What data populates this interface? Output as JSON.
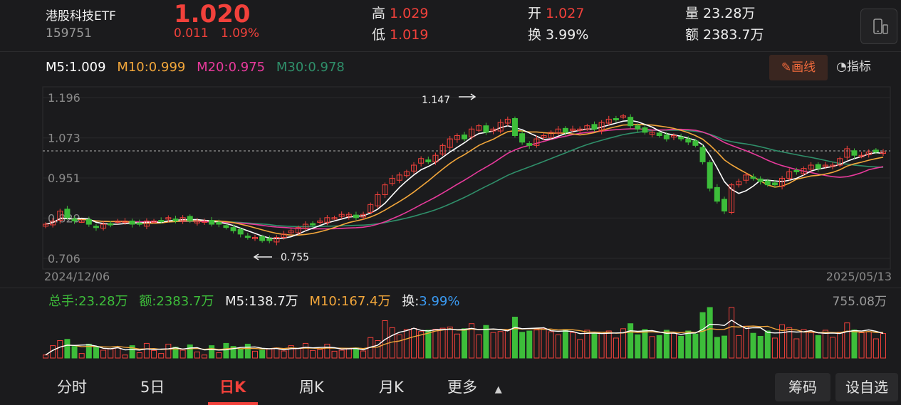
{
  "header": {
    "name": "港股科技ETF",
    "code": "159751",
    "price": "1.020",
    "change": "0.011",
    "change_pct": "1.09%",
    "high_label": "高",
    "high": "1.029",
    "low_label": "低",
    "low": "1.019",
    "open_label": "开",
    "open": "1.027",
    "turnover_label": "换",
    "turnover": "3.99%",
    "volume_label": "量",
    "volume": "23.28万",
    "amount_label": "额",
    "amount": "2383.7万"
  },
  "ma_legend": {
    "ma5": "M5:1.009",
    "ma10": "M10:0.999",
    "ma20": "M20:0.975",
    "ma30": "M30:0.978"
  },
  "colors": {
    "up": "#f2413b",
    "down": "#3dbd3a",
    "ma5": "#ffffff",
    "ma10": "#f3a73b",
    "ma20": "#e83a9c",
    "ma30": "#2f8f6a",
    "turnover": "#3a9af2",
    "accent": "#f06a3c"
  },
  "toolbar": {
    "draw_label": "画线",
    "indicator_label": "指标"
  },
  "chart": {
    "y_ticks": [
      "1.196",
      "1.073",
      "0.951",
      "0.829",
      "0.706"
    ],
    "start_date": "2024/12/06",
    "end_date": "2025/05/13",
    "high_annotation": "1.147",
    "low_annotation": "0.755"
  },
  "volume": {
    "total": "总手:23.28万",
    "amount": "额:2383.7万",
    "ma5": "M5:138.7万",
    "ma10": "M10:167.4万",
    "turnover_label": "换:",
    "turnover_value": "3.99%",
    "max": "755.08万"
  },
  "tabs": [
    {
      "label": "分时"
    },
    {
      "label": "5日"
    },
    {
      "label": "日K"
    },
    {
      "label": "周K"
    },
    {
      "label": "月K"
    },
    {
      "label": "更多"
    }
  ],
  "buttons": {
    "chips": "筹码",
    "settings": "设自选"
  },
  "icons": {
    "draw": "pencil-icon",
    "indicator": "gauge-icon",
    "more": "triangle-up-icon",
    "phone": "phone-icon"
  },
  "chart_data": {
    "type": "candlestick",
    "y_range": [
      0.706,
      1.196
    ],
    "close_series": [
      0.81,
      0.82,
      0.85,
      0.83,
      0.82,
      0.82,
      0.81,
      0.8,
      0.81,
      0.81,
      0.82,
      0.82,
      0.81,
      0.81,
      0.82,
      0.82,
      0.82,
      0.83,
      0.82,
      0.83,
      0.82,
      0.82,
      0.82,
      0.81,
      0.81,
      0.8,
      0.79,
      0.78,
      0.77,
      0.77,
      0.76,
      0.76,
      0.77,
      0.78,
      0.79,
      0.8,
      0.81,
      0.81,
      0.82,
      0.83,
      0.83,
      0.84,
      0.84,
      0.83,
      0.84,
      0.87,
      0.9,
      0.93,
      0.95,
      0.96,
      0.97,
      0.99,
      1.01,
      1.0,
      1.02,
      1.05,
      1.07,
      1.08,
      1.07,
      1.1,
      1.11,
      1.09,
      1.1,
      1.12,
      1.13,
      1.08,
      1.06,
      1.05,
      1.07,
      1.08,
      1.09,
      1.1,
      1.09,
      1.1,
      1.1,
      1.11,
      1.1,
      1.12,
      1.13,
      1.13,
      1.14,
      1.11,
      1.1,
      1.09,
      1.09,
      1.08,
      1.07,
      1.08,
      1.07,
      1.06,
      1.05,
      1.0,
      0.92,
      0.88,
      0.85,
      0.93,
      0.94,
      0.96,
      0.95,
      0.94,
      0.93,
      0.93,
      0.95,
      0.97,
      0.97,
      0.98,
      0.99,
      0.98,
      0.99,
      0.99,
      1.01,
      1.04,
      1.02,
      1.02,
      1.03,
      1.03,
      1.03
    ],
    "volume_max": "755.08万"
  }
}
